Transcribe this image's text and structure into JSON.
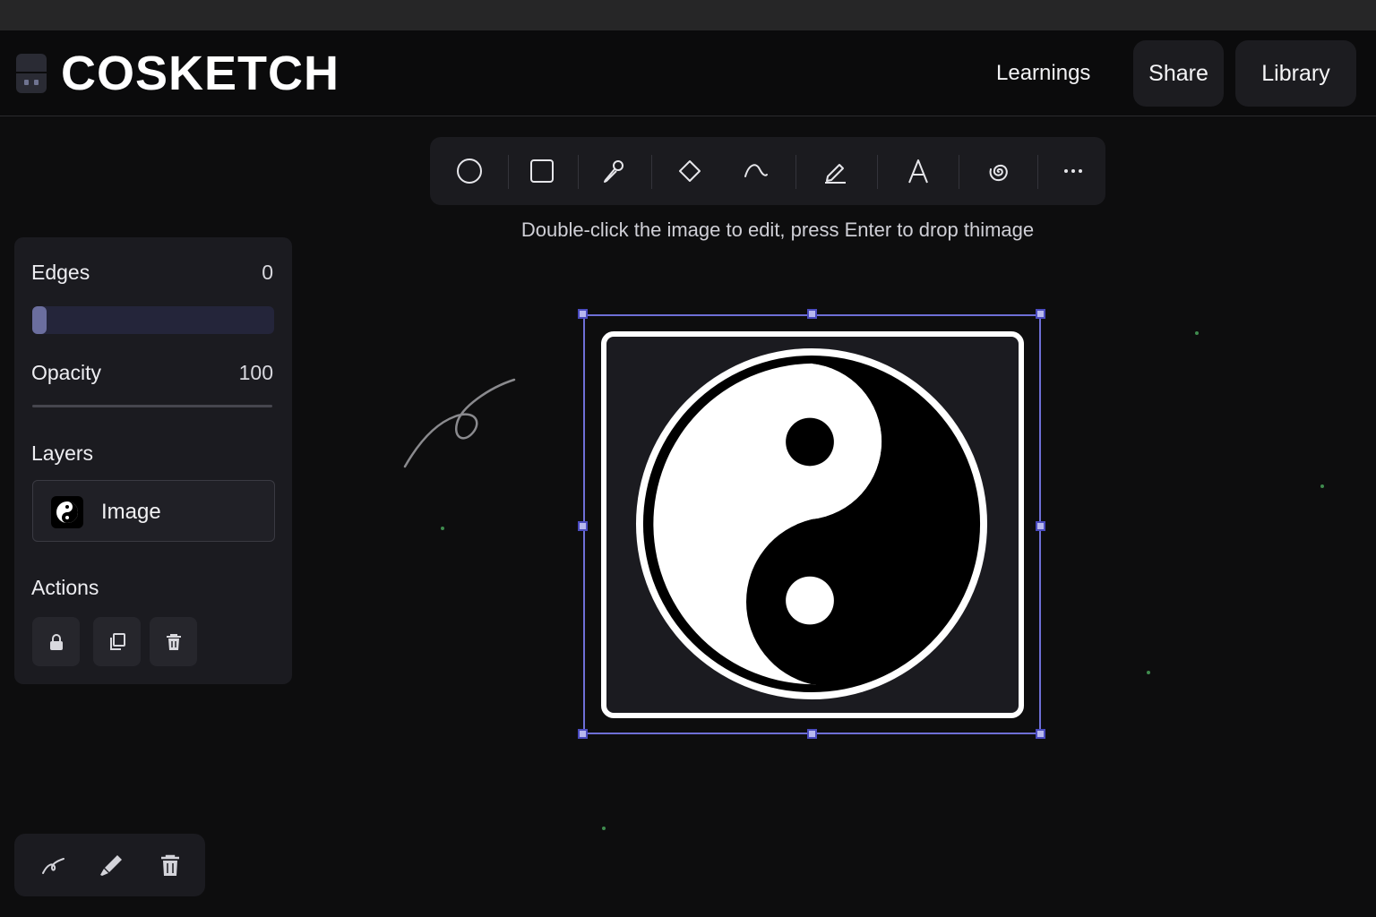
{
  "header": {
    "brand": "COSKETCH",
    "nav_link": "Learnings",
    "share_label": "Share",
    "library_label": "Library"
  },
  "toolbar": {
    "tools": [
      "circle-icon",
      "square-icon",
      "pen-icon",
      "diamond-icon",
      "curve-icon",
      "highlighter-icon",
      "text-icon",
      "spiral-icon",
      "more-icon"
    ],
    "hint": "Double-click the image to edit, press Enter to drop thimage"
  },
  "panel": {
    "edges_label": "Edges",
    "edges_value": "0",
    "edges_level": 0,
    "opacity_label": "Opacity",
    "opacity_value": "100",
    "layers_label": "Layers",
    "layer_name": "Image",
    "actions_label": "Actions",
    "actions": [
      "lock-icon",
      "duplicate-icon",
      "trash-icon"
    ]
  },
  "bottom_bar": {
    "tools": [
      "sketch-icon",
      "brush-icon",
      "trash-icon"
    ]
  },
  "colors": {
    "background": "#0d0d0e",
    "panel": "#1b1b20",
    "selection": "#6e6fd6",
    "accent_track": "#6b6e9e"
  }
}
